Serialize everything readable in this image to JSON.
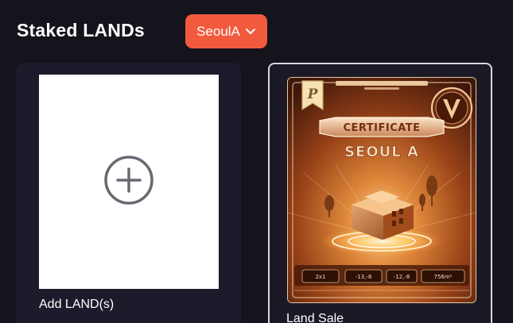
{
  "header": {
    "title": "Staked LANDs",
    "city_dropdown": {
      "selected": "SeoulA"
    }
  },
  "add_card": {
    "label": "Add LAND(s)"
  },
  "land_card": {
    "label": "Land Sale",
    "certificate": {
      "heading": "CERTIFICATE",
      "city": "SEOUL A",
      "stats": [
        "2x1",
        "-13,-8",
        "-12,-8",
        "756m²"
      ]
    }
  },
  "colors": {
    "background": "#15131c",
    "card": "#1d1a2b",
    "accent": "#f25a3e"
  },
  "icons": {
    "dropdown": "chevron-down-icon",
    "add": "plus-circle-icon",
    "brand_badge": "p-badge-icon",
    "emblem": "v-emblem-icon"
  }
}
